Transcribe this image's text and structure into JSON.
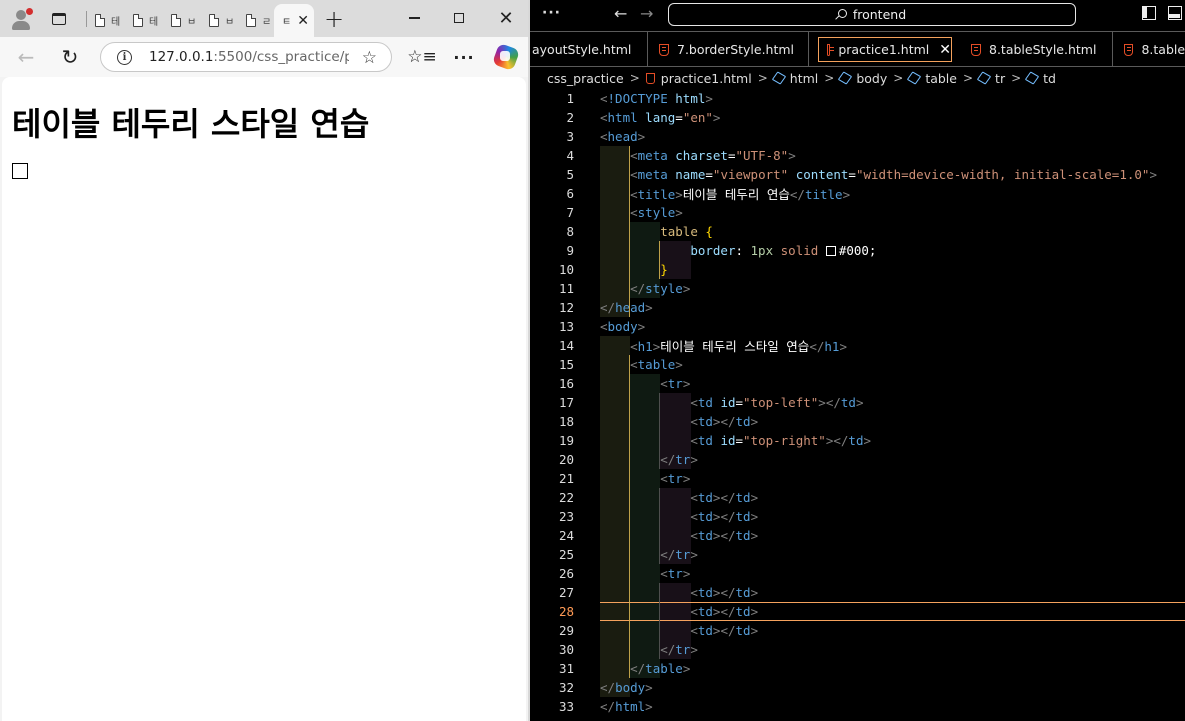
{
  "browser": {
    "tabs": [
      {
        "label": "테"
      },
      {
        "label": "테"
      },
      {
        "label": "ㅂ"
      },
      {
        "label": "ㅂ"
      },
      {
        "label": "ㄹ"
      }
    ],
    "active_tab": {
      "label": "ㅌ"
    },
    "url": {
      "host": "127.0.0.1",
      "rest": ":5500/css_practice/p..."
    },
    "page": {
      "heading": "테이블 테두리 스타일 연습"
    }
  },
  "editor": {
    "titlebar": {
      "search": "frontend"
    },
    "tabs": [
      {
        "label": "ayoutStyle.html"
      },
      {
        "label": "7.borderStyle.html"
      },
      {
        "label": "practice1.html",
        "active": true
      },
      {
        "label": "8.tableStyle.html"
      },
      {
        "label": "8.tableS"
      }
    ],
    "breadcrumb": [
      "css_practice",
      "practice1.html",
      "html",
      "body",
      "table",
      "tr",
      "td"
    ],
    "current_line": 28,
    "lines": [
      "<!DOCTYPE html>",
      "<html lang=\"en\">",
      "<head>",
      "    <meta charset=\"UTF-8\">",
      "    <meta name=\"viewport\" content=\"width=device-width, initial-scale=1.0\">",
      "    <title>테이블 테두리 연습</title>",
      "    <style>",
      "        table {",
      "            border: 1px solid #000;",
      "        }",
      "    </style>",
      "</head>",
      "<body>",
      "    <h1>테이블 테두리 스타일 연습</h1>",
      "    <table>",
      "        <tr>",
      "            <td id=\"top-left\"></td>",
      "            <td></td>",
      "            <td id=\"top-right\"></td>",
      "        </tr>",
      "        <tr>",
      "            <td></td>",
      "            <td></td>",
      "            <td></td>",
      "        </tr>",
      "        <tr>",
      "            <td></td>",
      "            <td></td>",
      "            <td></td>",
      "        </tr>",
      "    </table>",
      "</body>",
      "</html>"
    ]
  },
  "colors": {
    "tag": "#569cd6",
    "attr": "#9cdcfe",
    "string": "#ce9178",
    "accent": "#f5a25d"
  }
}
